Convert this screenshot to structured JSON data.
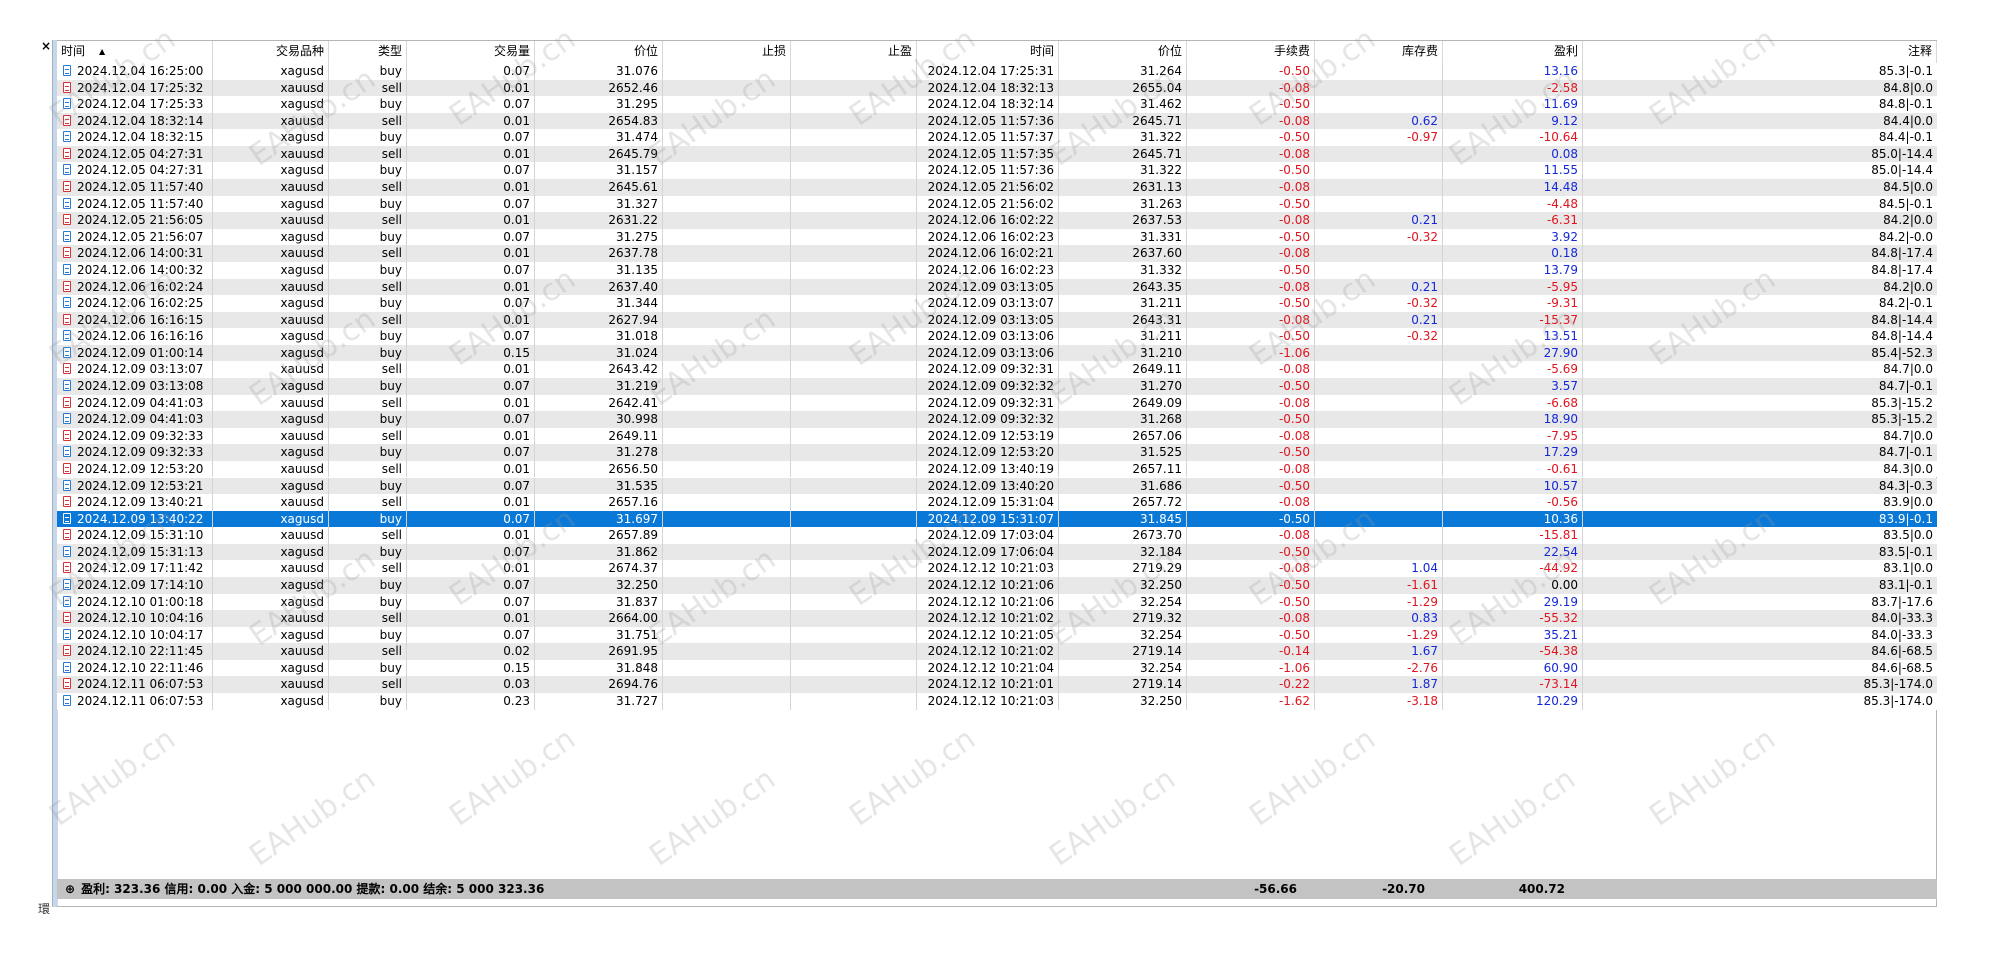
{
  "panel": {
    "close_glyph": "×",
    "side_label": "環"
  },
  "columns": [
    "时间",
    "交易品种",
    "类型",
    "交易量",
    "价位",
    "止损",
    "止盈",
    "时间",
    "价位",
    "手续费",
    "库存费",
    "盈利",
    "注释"
  ],
  "sort_indicator": "▲",
  "selected_row": 27,
  "rows": [
    [
      "2024.12.04 16:25:00",
      "xagusd",
      "buy",
      "0.07",
      "31.076",
      "",
      "",
      "2024.12.04 17:25:31",
      "31.264",
      "-0.50",
      "",
      "13.16",
      "85.3|-0.1"
    ],
    [
      "2024.12.04 17:25:32",
      "xauusd",
      "sell",
      "0.01",
      "2652.46",
      "",
      "",
      "2024.12.04 18:32:13",
      "2655.04",
      "-0.08",
      "",
      "-2.58",
      "84.8|0.0"
    ],
    [
      "2024.12.04 17:25:33",
      "xagusd",
      "buy",
      "0.07",
      "31.295",
      "",
      "",
      "2024.12.04 18:32:14",
      "31.462",
      "-0.50",
      "",
      "11.69",
      "84.8|-0.1"
    ],
    [
      "2024.12.04 18:32:14",
      "xauusd",
      "sell",
      "0.01",
      "2654.83",
      "",
      "",
      "2024.12.05 11:57:36",
      "2645.71",
      "-0.08",
      "0.62",
      "9.12",
      "84.4|0.0"
    ],
    [
      "2024.12.04 18:32:15",
      "xagusd",
      "buy",
      "0.07",
      "31.474",
      "",
      "",
      "2024.12.05 11:57:37",
      "31.322",
      "-0.50",
      "-0.97",
      "-10.64",
      "84.4|-0.1"
    ],
    [
      "2024.12.05 04:27:31",
      "xauusd",
      "sell",
      "0.01",
      "2645.79",
      "",
      "",
      "2024.12.05 11:57:35",
      "2645.71",
      "-0.08",
      "",
      "0.08",
      "85.0|-14.4"
    ],
    [
      "2024.12.05 04:27:31",
      "xagusd",
      "buy",
      "0.07",
      "31.157",
      "",
      "",
      "2024.12.05 11:57:36",
      "31.322",
      "-0.50",
      "",
      "11.55",
      "85.0|-14.4"
    ],
    [
      "2024.12.05 11:57:40",
      "xauusd",
      "sell",
      "0.01",
      "2645.61",
      "",
      "",
      "2024.12.05 21:56:02",
      "2631.13",
      "-0.08",
      "",
      "14.48",
      "84.5|0.0"
    ],
    [
      "2024.12.05 11:57:40",
      "xagusd",
      "buy",
      "0.07",
      "31.327",
      "",
      "",
      "2024.12.05 21:56:02",
      "31.263",
      "-0.50",
      "",
      "-4.48",
      "84.5|-0.1"
    ],
    [
      "2024.12.05 21:56:05",
      "xauusd",
      "sell",
      "0.01",
      "2631.22",
      "",
      "",
      "2024.12.06 16:02:22",
      "2637.53",
      "-0.08",
      "0.21",
      "-6.31",
      "84.2|0.0"
    ],
    [
      "2024.12.05 21:56:07",
      "xagusd",
      "buy",
      "0.07",
      "31.275",
      "",
      "",
      "2024.12.06 16:02:23",
      "31.331",
      "-0.50",
      "-0.32",
      "3.92",
      "84.2|-0.0"
    ],
    [
      "2024.12.06 14:00:31",
      "xauusd",
      "sell",
      "0.01",
      "2637.78",
      "",
      "",
      "2024.12.06 16:02:21",
      "2637.60",
      "-0.08",
      "",
      "0.18",
      "84.8|-17.4"
    ],
    [
      "2024.12.06 14:00:32",
      "xagusd",
      "buy",
      "0.07",
      "31.135",
      "",
      "",
      "2024.12.06 16:02:23",
      "31.332",
      "-0.50",
      "",
      "13.79",
      "84.8|-17.4"
    ],
    [
      "2024.12.06 16:02:24",
      "xauusd",
      "sell",
      "0.01",
      "2637.40",
      "",
      "",
      "2024.12.09 03:13:05",
      "2643.35",
      "-0.08",
      "0.21",
      "-5.95",
      "84.2|0.0"
    ],
    [
      "2024.12.06 16:02:25",
      "xagusd",
      "buy",
      "0.07",
      "31.344",
      "",
      "",
      "2024.12.09 03:13:07",
      "31.211",
      "-0.50",
      "-0.32",
      "-9.31",
      "84.2|-0.1"
    ],
    [
      "2024.12.06 16:16:15",
      "xauusd",
      "sell",
      "0.01",
      "2627.94",
      "",
      "",
      "2024.12.09 03:13:05",
      "2643.31",
      "-0.08",
      "0.21",
      "-15.37",
      "84.8|-14.4"
    ],
    [
      "2024.12.06 16:16:16",
      "xagusd",
      "buy",
      "0.07",
      "31.018",
      "",
      "",
      "2024.12.09 03:13:06",
      "31.211",
      "-0.50",
      "-0.32",
      "13.51",
      "84.8|-14.4"
    ],
    [
      "2024.12.09 01:00:14",
      "xagusd",
      "buy",
      "0.15",
      "31.024",
      "",
      "",
      "2024.12.09 03:13:06",
      "31.210",
      "-1.06",
      "",
      "27.90",
      "85.4|-52.3"
    ],
    [
      "2024.12.09 03:13:07",
      "xauusd",
      "sell",
      "0.01",
      "2643.42",
      "",
      "",
      "2024.12.09 09:32:31",
      "2649.11",
      "-0.08",
      "",
      "-5.69",
      "84.7|0.0"
    ],
    [
      "2024.12.09 03:13:08",
      "xagusd",
      "buy",
      "0.07",
      "31.219",
      "",
      "",
      "2024.12.09 09:32:32",
      "31.270",
      "-0.50",
      "",
      "3.57",
      "84.7|-0.1"
    ],
    [
      "2024.12.09 04:41:03",
      "xauusd",
      "sell",
      "0.01",
      "2642.41",
      "",
      "",
      "2024.12.09 09:32:31",
      "2649.09",
      "-0.08",
      "",
      "-6.68",
      "85.3|-15.2"
    ],
    [
      "2024.12.09 04:41:03",
      "xagusd",
      "buy",
      "0.07",
      "30.998",
      "",
      "",
      "2024.12.09 09:32:32",
      "31.268",
      "-0.50",
      "",
      "18.90",
      "85.3|-15.2"
    ],
    [
      "2024.12.09 09:32:33",
      "xauusd",
      "sell",
      "0.01",
      "2649.11",
      "",
      "",
      "2024.12.09 12:53:19",
      "2657.06",
      "-0.08",
      "",
      "-7.95",
      "84.7|0.0"
    ],
    [
      "2024.12.09 09:32:33",
      "xagusd",
      "buy",
      "0.07",
      "31.278",
      "",
      "",
      "2024.12.09 12:53:20",
      "31.525",
      "-0.50",
      "",
      "17.29",
      "84.7|-0.1"
    ],
    [
      "2024.12.09 12:53:20",
      "xauusd",
      "sell",
      "0.01",
      "2656.50",
      "",
      "",
      "2024.12.09 13:40:19",
      "2657.11",
      "-0.08",
      "",
      "-0.61",
      "84.3|0.0"
    ],
    [
      "2024.12.09 12:53:21",
      "xagusd",
      "buy",
      "0.07",
      "31.535",
      "",
      "",
      "2024.12.09 13:40:20",
      "31.686",
      "-0.50",
      "",
      "10.57",
      "84.3|-0.3"
    ],
    [
      "2024.12.09 13:40:21",
      "xauusd",
      "sell",
      "0.01",
      "2657.16",
      "",
      "",
      "2024.12.09 15:31:04",
      "2657.72",
      "-0.08",
      "",
      "-0.56",
      "83.9|0.0"
    ],
    [
      "2024.12.09 13:40:22",
      "xagusd",
      "buy",
      "0.07",
      "31.697",
      "",
      "",
      "2024.12.09 15:31:07",
      "31.845",
      "-0.50",
      "",
      "10.36",
      "83.9|-0.1"
    ],
    [
      "2024.12.09 15:31:10",
      "xauusd",
      "sell",
      "0.01",
      "2657.89",
      "",
      "",
      "2024.12.09 17:03:04",
      "2673.70",
      "-0.08",
      "",
      "-15.81",
      "83.5|0.0"
    ],
    [
      "2024.12.09 15:31:13",
      "xagusd",
      "buy",
      "0.07",
      "31.862",
      "",
      "",
      "2024.12.09 17:06:04",
      "32.184",
      "-0.50",
      "",
      "22.54",
      "83.5|-0.1"
    ],
    [
      "2024.12.09 17:11:42",
      "xauusd",
      "sell",
      "0.01",
      "2674.37",
      "",
      "",
      "2024.12.12 10:21:03",
      "2719.29",
      "-0.08",
      "1.04",
      "-44.92",
      "83.1|0.0"
    ],
    [
      "2024.12.09 17:14:10",
      "xagusd",
      "buy",
      "0.07",
      "32.250",
      "",
      "",
      "2024.12.12 10:21:06",
      "32.250",
      "-0.50",
      "-1.61",
      "0.00",
      "83.1|-0.1"
    ],
    [
      "2024.12.10 01:00:18",
      "xagusd",
      "buy",
      "0.07",
      "31.837",
      "",
      "",
      "2024.12.12 10:21:06",
      "32.254",
      "-0.50",
      "-1.29",
      "29.19",
      "83.7|-17.6"
    ],
    [
      "2024.12.10 10:04:16",
      "xauusd",
      "sell",
      "0.01",
      "2664.00",
      "",
      "",
      "2024.12.12 10:21:02",
      "2719.32",
      "-0.08",
      "0.83",
      "-55.32",
      "84.0|-33.3"
    ],
    [
      "2024.12.10 10:04:17",
      "xagusd",
      "buy",
      "0.07",
      "31.751",
      "",
      "",
      "2024.12.12 10:21:05",
      "32.254",
      "-0.50",
      "-1.29",
      "35.21",
      "84.0|-33.3"
    ],
    [
      "2024.12.10 22:11:45",
      "xauusd",
      "sell",
      "0.02",
      "2691.95",
      "",
      "",
      "2024.12.12 10:21:02",
      "2719.14",
      "-0.14",
      "1.67",
      "-54.38",
      "84.6|-68.5"
    ],
    [
      "2024.12.10 22:11:46",
      "xagusd",
      "buy",
      "0.15",
      "31.848",
      "",
      "",
      "2024.12.12 10:21:04",
      "32.254",
      "-1.06",
      "-2.76",
      "60.90",
      "84.6|-68.5"
    ],
    [
      "2024.12.11 06:07:53",
      "xauusd",
      "sell",
      "0.03",
      "2694.76",
      "",
      "",
      "2024.12.12 10:21:01",
      "2719.14",
      "-0.22",
      "1.87",
      "-73.14",
      "85.3|-174.0"
    ],
    [
      "2024.12.11 06:07:53",
      "xagusd",
      "buy",
      "0.23",
      "31.727",
      "",
      "",
      "2024.12.12 10:21:03",
      "32.250",
      "-1.62",
      "-3.18",
      "120.29",
      "85.3|-174.0"
    ]
  ],
  "summary": {
    "icon": "⊕",
    "text": "盈利: 323.36  信用: 0.00  入金: 5 000 000.00  提款: 0.00  结余: 5 000 323.36",
    "commission": "-56.66",
    "swap": "-20.70",
    "profit": "400.72"
  },
  "watermark": "EAHub.cn",
  "colors": {
    "selected": "#0a78d7",
    "negative": "#e0141e",
    "positive": "#1428d8",
    "stripe": "#e8e8e8"
  }
}
